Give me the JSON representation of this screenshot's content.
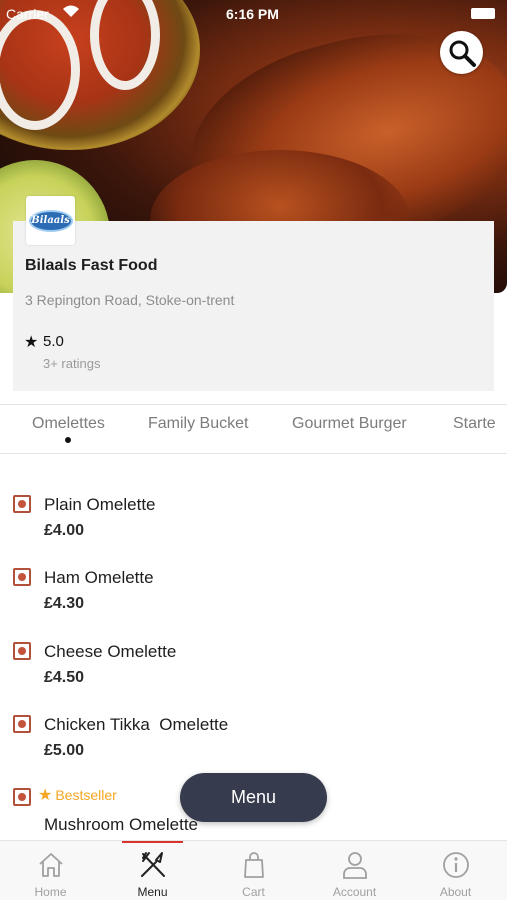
{
  "status_bar": {
    "carrier": "Carrier",
    "time": "6:16 PM"
  },
  "restaurant": {
    "name": "Bilaals Fast Food",
    "logo_text": "Bilaals",
    "address": "3 Repington Road, Stoke-on-trent",
    "rating": "5.0",
    "ratings_count": "3+ ratings"
  },
  "tabs": [
    {
      "label": "Omelettes",
      "active": true
    },
    {
      "label": "Family Bucket"
    },
    {
      "label": "Gourmet Burger"
    },
    {
      "label": "Starte"
    }
  ],
  "items": [
    {
      "name": "Plain Omelette",
      "price": "£4.00"
    },
    {
      "name": "Ham Omelette",
      "price": "£4.30"
    },
    {
      "name": "Cheese Omelette",
      "price": "£4.50"
    },
    {
      "name": "Chicken Tikka  Omelette",
      "price": "£5.00"
    },
    {
      "name": "Mushroom Omelette",
      "badge": "Bestseller"
    }
  ],
  "menu_button": "Menu",
  "nav": [
    {
      "label": "Home",
      "icon": "home-icon"
    },
    {
      "label": "Menu",
      "icon": "fork-knife-icon",
      "active": true
    },
    {
      "label": "Cart",
      "icon": "shopping-bag-icon"
    },
    {
      "label": "Account",
      "icon": "user-icon"
    },
    {
      "label": "About",
      "icon": "info-icon"
    }
  ],
  "colors": {
    "accent": "#d9332b",
    "veg_marker": "#c4533b",
    "bestseller": "#f5a623",
    "fab": "#363c4e"
  }
}
